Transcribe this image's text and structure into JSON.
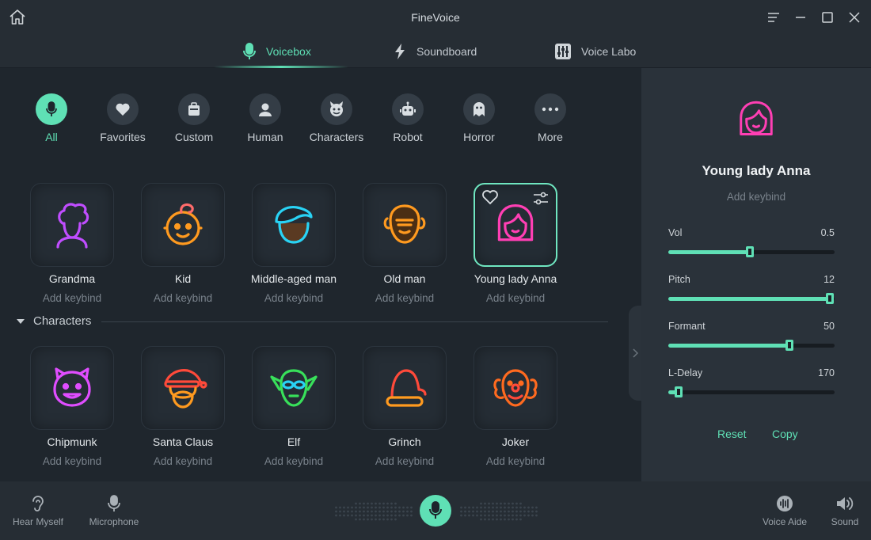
{
  "app": {
    "title": "FineVoice"
  },
  "tabs": [
    {
      "label": "Voicebox",
      "icon": "microphone-icon",
      "active": true
    },
    {
      "label": "Soundboard",
      "icon": "lightning-icon",
      "active": false
    },
    {
      "label": "Voice Labo",
      "icon": "sliders-icon",
      "active": false
    }
  ],
  "categories": [
    {
      "label": "All",
      "icon": "microphone-icon",
      "active": true
    },
    {
      "label": "Favorites",
      "icon": "heart-icon"
    },
    {
      "label": "Custom",
      "icon": "robot-box-icon"
    },
    {
      "label": "Human",
      "icon": "person-icon"
    },
    {
      "label": "Characters",
      "icon": "devil-icon"
    },
    {
      "label": "Robot",
      "icon": "robot-icon"
    },
    {
      "label": "Horror",
      "icon": "ghost-icon"
    },
    {
      "label": "More",
      "icon": "more-icon"
    }
  ],
  "voices": [
    {
      "name": "Grandma",
      "keybind": "Add keybind",
      "icon": "grandma-icon",
      "color": "#c04dff"
    },
    {
      "name": "Kid",
      "keybind": "Add keybind",
      "icon": "kid-icon",
      "color": "#ff9a1f"
    },
    {
      "name": "Middle-aged man",
      "keybind": "Add keybind",
      "icon": "middle-aged-man-icon",
      "color": "#29d3f5"
    },
    {
      "name": "Old man",
      "keybind": "Add keybind",
      "icon": "old-man-icon",
      "color": "#ff9a1f"
    },
    {
      "name": "Young lady Anna",
      "keybind": "Add keybind",
      "icon": "young-lady-icon",
      "color": "#ff3fb4",
      "selected": true
    }
  ],
  "characters_section": {
    "label": "Characters"
  },
  "characters": [
    {
      "name": "Chipmunk",
      "keybind": "Add keybind",
      "icon": "chipmunk-icon",
      "color": "#e04dff"
    },
    {
      "name": "Santa Claus",
      "keybind": "Add keybind",
      "icon": "santa-claus-icon",
      "color": "#ff4a3a"
    },
    {
      "name": "Elf",
      "keybind": "Add keybind",
      "icon": "elf-icon",
      "color": "#38e05a"
    },
    {
      "name": "Grinch",
      "keybind": "Add keybind",
      "icon": "grinch-icon",
      "color": "#ff4a3a"
    },
    {
      "name": "Joker",
      "keybind": "Add keybind",
      "icon": "joker-icon",
      "color": "#ff6a1f"
    }
  ],
  "detail": {
    "name": "Young lady Anna",
    "keybind": "Add keybind",
    "sliders": [
      {
        "label": "Vol",
        "value": "0.5",
        "fraction": 0.49
      },
      {
        "label": "Pitch",
        "value": "12",
        "fraction": 0.97
      },
      {
        "label": "Formant",
        "value": "50",
        "fraction": 0.73
      },
      {
        "label": "L-Delay",
        "value": "170",
        "fraction": 0.06
      }
    ],
    "reset_label": "Reset",
    "copy_label": "Copy"
  },
  "bottom": {
    "hear_myself": "Hear Myself",
    "microphone": "Microphone",
    "voice_aide": "Voice Aide",
    "sound": "Sound"
  },
  "colors": {
    "accent": "#5fe0b5",
    "background": "#1e252c",
    "panel": "#2a323a"
  }
}
